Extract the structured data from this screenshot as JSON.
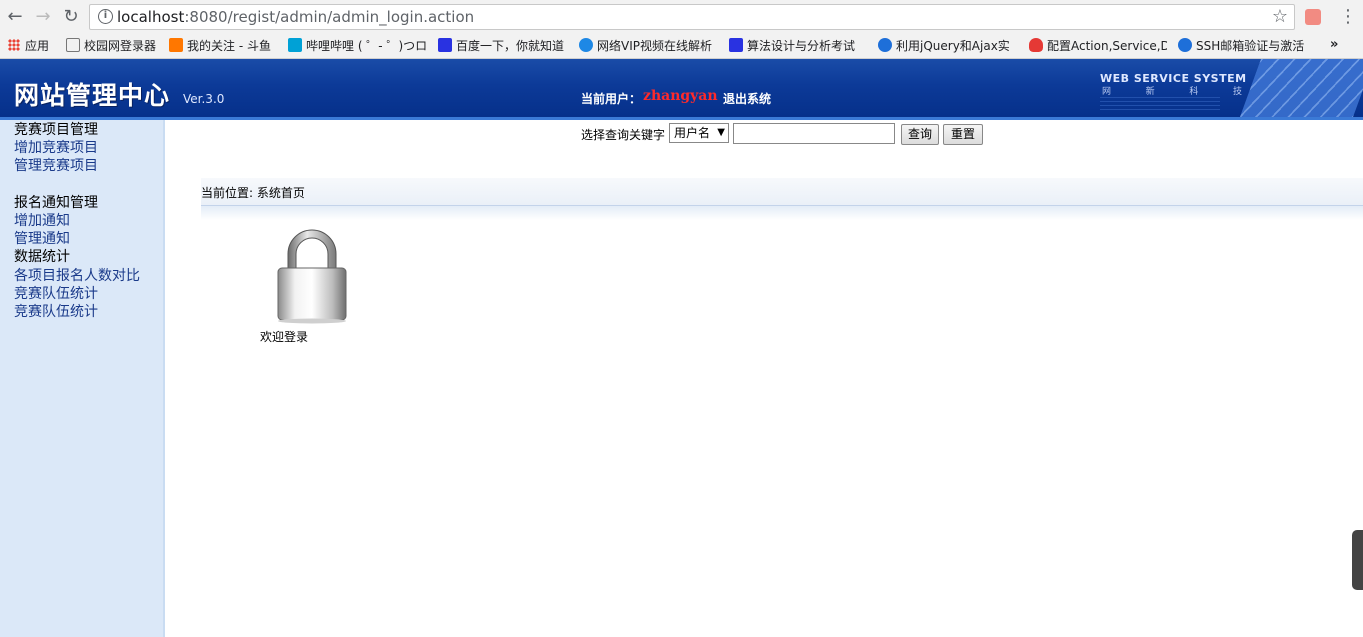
{
  "browser": {
    "url_host": "localhost",
    "url_path": ":8080/regist/admin/admin_login.action",
    "bookmarks": [
      {
        "label": "应用",
        "color": "#ea4335"
      },
      {
        "label": "校园网登录器",
        "color": "#ffffff"
      },
      {
        "label": "我的关注 - 斗鱼",
        "color": "#ff7700"
      },
      {
        "label": "哔哩哔哩 ( ゜- ゜)つロ",
        "color": "#00a1d6"
      },
      {
        "label": "百度一下，你就知道",
        "color": "#2932e1"
      },
      {
        "label": "网络VIP视频在线解析",
        "color": "#1e88e5"
      },
      {
        "label": "算法设计与分析考试",
        "color": "#2932e1"
      },
      {
        "label": "利用jQuery和Ajax实",
        "color": "#1e6fd9"
      },
      {
        "label": "配置Action,Service,D",
        "color": "#e53935"
      },
      {
        "label": "SSH邮箱验证与激活",
        "color": "#1e6fd9"
      }
    ],
    "more": "»"
  },
  "header": {
    "logo": "网站管理中心",
    "version": "Ver.3.0",
    "current_user_label": "当前用户：",
    "current_user": "zhangyan",
    "logout": "退出系统",
    "ws_title": "WEB SERVICE SYSTEM",
    "ws_sub": [
      "网",
      "新",
      "科",
      "技"
    ]
  },
  "sidebar": {
    "lines": [
      "竞赛项目管理",
      "增加竞赛项目",
      "管理竞赛项目",
      "",
      "报名通知管理",
      "增加通知",
      "管理通知",
      "数据统计",
      "各项目报名人数对比",
      "竞赛队伍统计",
      "竞赛队伍统计"
    ]
  },
  "search": {
    "label": "选择查询关键字",
    "select_value": "用户名",
    "input_value": "",
    "query_button": "查询",
    "reset_button": "重置"
  },
  "breadcrumb": "当前位置: 系统首页",
  "welcome": "欢迎登录"
}
